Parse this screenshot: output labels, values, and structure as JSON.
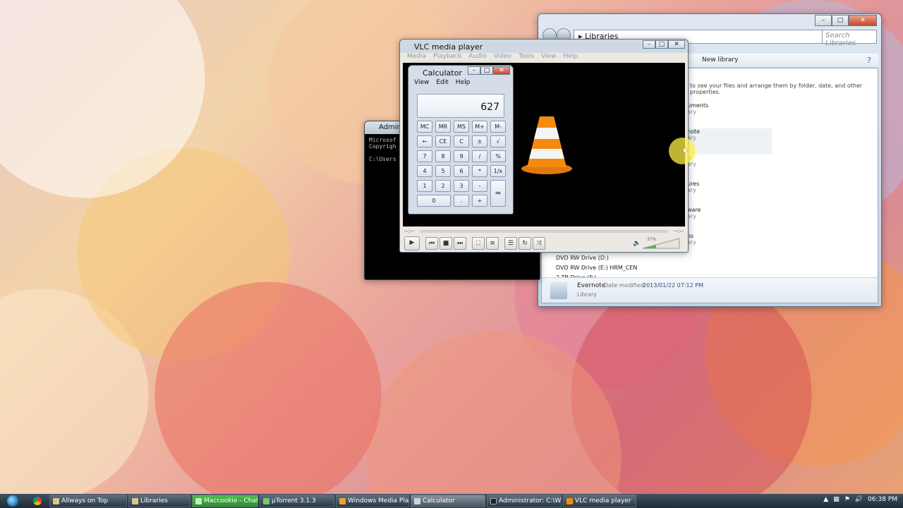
{
  "explorer": {
    "address": "Libraries",
    "search_placeholder": "Search Libraries",
    "new_library": "New library",
    "hint": "to see your files and arrange them by folder, date, and other properties.",
    "libs": [
      {
        "name": "uments",
        "sub": "ary"
      },
      {
        "name": "note",
        "sub": "ary"
      },
      {
        "name": "ic",
        "sub": "ary"
      },
      {
        "name": "ures",
        "sub": "ary"
      },
      {
        "name": "ware",
        "sub": "ary"
      },
      {
        "name": "os",
        "sub": "ary"
      }
    ],
    "drives": [
      "DVD RW Drive (D:)",
      "DVD RW Drive (E:) HRM_CEN",
      "2 TB Drive (F:)"
    ],
    "details": {
      "name": "Evernote",
      "date_label": "Date modified:",
      "date": "2013/01/22 07:12 PM",
      "type": "Library"
    }
  },
  "vlc": {
    "title": "VLC media player",
    "menu": [
      "Media",
      "Playback",
      "Audio",
      "Video",
      "Tools",
      "View",
      "Help"
    ],
    "time_left": "--:--",
    "time_right": "--:--",
    "volume": "37%"
  },
  "cmd": {
    "title": "Administ",
    "lines": [
      "Microsof",
      "Copyrigh",
      "",
      "C:\\Users"
    ]
  },
  "calc": {
    "title": "Calculator",
    "menu": [
      "View",
      "Edit",
      "Help"
    ],
    "display": "627",
    "keys": [
      "MC",
      "MR",
      "MS",
      "M+",
      "M-",
      "←",
      "CE",
      "C",
      "±",
      "√",
      "7",
      "8",
      "9",
      "/",
      "%",
      "4",
      "5",
      "6",
      "*",
      "1/x",
      "1",
      "2",
      "3",
      "-",
      "=",
      "0",
      ".",
      "+"
    ]
  },
  "taskbar": {
    "items": [
      {
        "label": "Allways on Top",
        "state": "normal"
      },
      {
        "label": "Libraries",
        "state": "normal"
      },
      {
        "label": "Maccookie - Chat",
        "state": "green"
      },
      {
        "label": "µTorrent 3.1.3",
        "state": "normal"
      },
      {
        "label": "Windows Media Player",
        "state": "normal"
      },
      {
        "label": "Calculator",
        "state": "active"
      },
      {
        "label": "Administrator: C:\\Wi...",
        "state": "normal"
      },
      {
        "label": "VLC media player",
        "state": "normal"
      }
    ],
    "clock": "06:38 PM"
  }
}
